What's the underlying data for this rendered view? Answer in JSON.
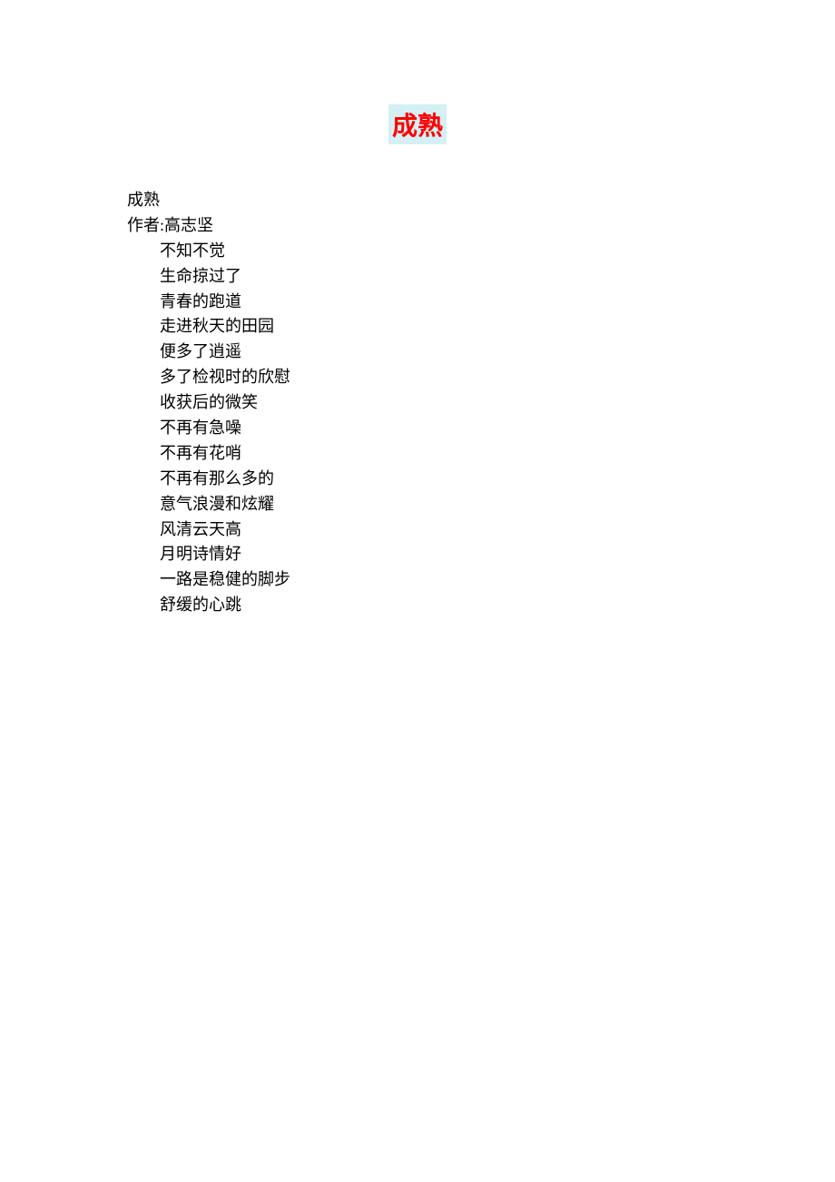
{
  "title": "成熟",
  "header": {
    "poem_title": "成熟",
    "author_line": "作者:高志坚"
  },
  "lines": [
    "不知不觉",
    "生命掠过了",
    "青春的跑道",
    "走进秋天的田园",
    "便多了逍遥",
    "多了检视时的欣慰",
    "收获后的微笑",
    "不再有急噪",
    "不再有花哨",
    "不再有那么多的",
    "意气浪漫和炫耀",
    "风清云天高",
    "月明诗情好",
    "一路是稳健的脚步",
    "舒缓的心跳"
  ]
}
